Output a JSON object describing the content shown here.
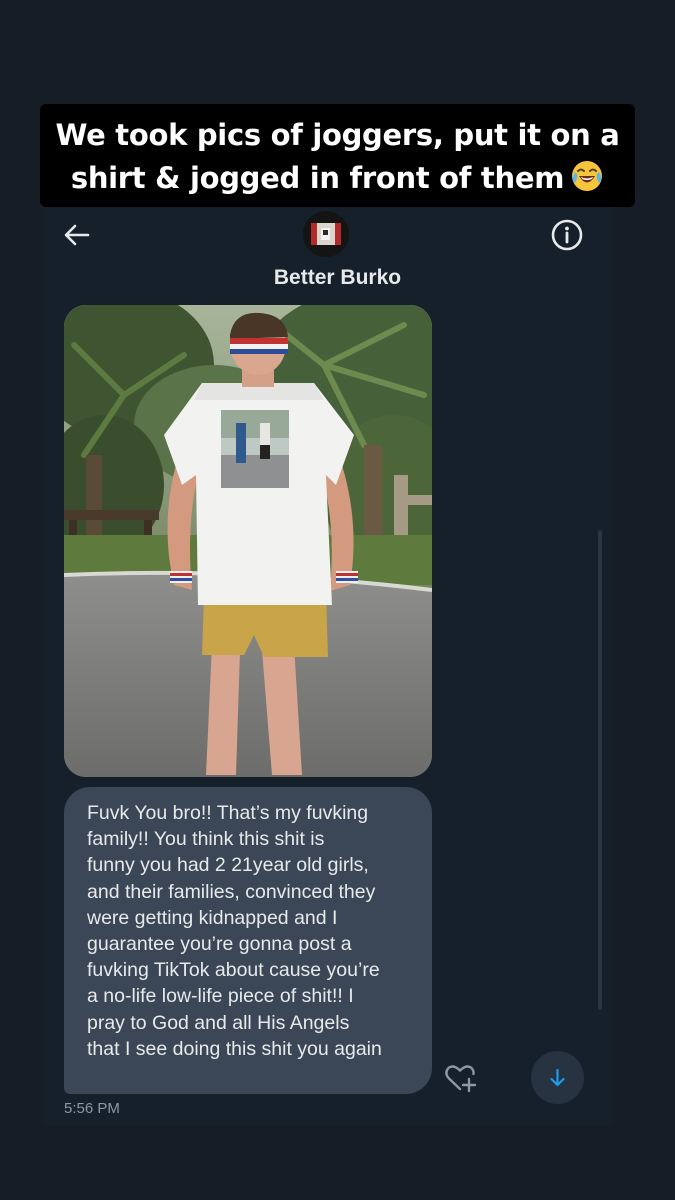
{
  "caption": {
    "line1": "We took pics of joggers, put it on a",
    "line2": "shirt & jogged in front of them",
    "emoji": "face-with-tears-of-joy"
  },
  "header": {
    "back_icon": "arrow-left-icon",
    "info_icon": "info-circle-icon",
    "contact_name": "Better Burko"
  },
  "message": {
    "lines": [
      "Fuvk You bro!! That’s my fuvking",
      "family!! You think this shit is",
      "funny you had 2 21year old girls,",
      "and their families, convinced they",
      "were getting kidnapped and I",
      "guarantee you’re gonna post a",
      "fuvking TikTok about cause you’re",
      "a no-life low-life piece of shit!! I",
      "pray to God and all His Angels",
      "that I see doing this shit you again"
    ],
    "timestamp": "5:56 PM"
  },
  "controls": {
    "react_icon": "heart-plus-icon",
    "scroll_icon": "arrow-down-icon"
  },
  "colors": {
    "background": "#15202b",
    "bubble": "#3b4757",
    "accent": "#1d9bf0",
    "muted_text": "#8b98a5"
  }
}
